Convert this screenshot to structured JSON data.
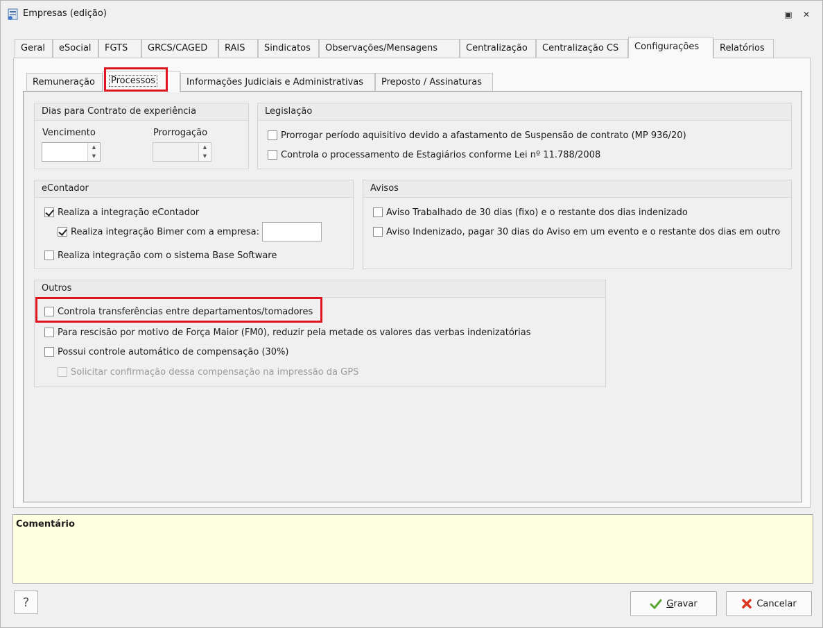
{
  "window": {
    "title": "Empresas (edição)"
  },
  "main_tabs": [
    {
      "label": "Geral"
    },
    {
      "label": "eSocial"
    },
    {
      "label": "FGTS"
    },
    {
      "label": "GRCS/CAGED"
    },
    {
      "label": "RAIS"
    },
    {
      "label": "Sindicatos"
    },
    {
      "label": "Observações/Mensagens"
    },
    {
      "label": "Centralização"
    },
    {
      "label": "Centralização CS"
    },
    {
      "label": "Configurações"
    },
    {
      "label": "Relatórios"
    }
  ],
  "sub_tabs": [
    {
      "label": "Remuneração"
    },
    {
      "label": "Processos"
    },
    {
      "label": "Informações Judiciais e Administrativas"
    },
    {
      "label": "Preposto / Assinaturas"
    }
  ],
  "dias_group": {
    "title": "Dias para Contrato de experiência",
    "vencimento_label": "Vencimento",
    "prorrogacao_label": "Prorrogação"
  },
  "legislacao_group": {
    "title": "Legislação",
    "items": [
      {
        "label": "Prorrogar período aquisitivo devido a afastamento de Suspensão de contrato (MP 936/20)",
        "checked": false
      },
      {
        "label": "Controla o processamento de Estagiários conforme Lei nº 11.788/2008",
        "checked": false
      }
    ]
  },
  "econtador_group": {
    "title": "eContador",
    "items": [
      {
        "label": "Realiza a integração eContador",
        "checked": true
      },
      {
        "label": "Realiza integração Bimer com a empresa:",
        "checked": true
      },
      {
        "label": "Realiza integração com o sistema Base Software",
        "checked": false
      }
    ]
  },
  "avisos_group": {
    "title": "Avisos",
    "items": [
      {
        "label": "Aviso Trabalhado de 30 dias (fixo) e o restante dos dias indenizado",
        "checked": false
      },
      {
        "label": "Aviso Indenizado, pagar 30 dias do Aviso em um evento e o restante dos dias em outro",
        "checked": false
      }
    ]
  },
  "outros_group": {
    "title": "Outros",
    "items": [
      {
        "label": "Controla transferências entre departamentos/tomadores",
        "checked": false
      },
      {
        "label": "Para rescisão por motivo de Força Maior (FM0), reduzir pela metade os valores das verbas indenizatórias",
        "checked": false
      },
      {
        "label": "Possui controle automático de compensação (30%)",
        "checked": false
      },
      {
        "label": "Solicitar confirmação dessa compensação na impressão da GPS",
        "checked": false,
        "disabled": true
      }
    ]
  },
  "comment": {
    "label": "Comentário"
  },
  "buttons": {
    "help": "?",
    "save": "Gravar",
    "cancel": "Cancelar"
  },
  "colors": {
    "highlight": "#e0141e",
    "comment_bg": "#fefee0",
    "save_icon": "#5aa632",
    "cancel_icon": "#d9381e"
  },
  "icons": {
    "app": "app-icon",
    "save": "check-icon",
    "cancel": "x-icon",
    "help": "question-icon"
  }
}
